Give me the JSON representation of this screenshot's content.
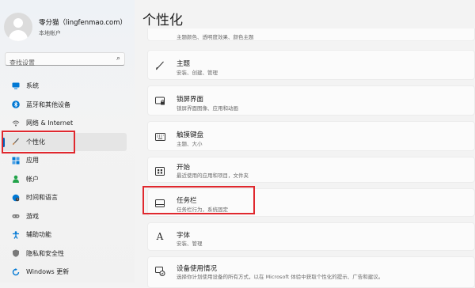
{
  "user": {
    "name": "零分猫（lingfenmao.com）",
    "account_type": "本地帐户"
  },
  "search": {
    "placeholder": "查找设置"
  },
  "sidebar": {
    "items": [
      {
        "label": "系统",
        "icon": "monitor-icon",
        "color": "#0078d4"
      },
      {
        "label": "蓝牙和其他设备",
        "icon": "bluetooth-icon",
        "color": "#0078d4"
      },
      {
        "label": "网络 & Internet",
        "icon": "wifi-icon",
        "color": "#606060"
      },
      {
        "label": "个性化",
        "icon": "brush-icon",
        "color": "#c07a3a"
      },
      {
        "label": "应用",
        "icon": "apps-icon",
        "color": "#0078d4"
      },
      {
        "label": "帐户",
        "icon": "account-icon",
        "color": "#22a34a"
      },
      {
        "label": "时间和语言",
        "icon": "globe-clock-icon",
        "color": "#0078d4"
      },
      {
        "label": "游戏",
        "icon": "gamepad-icon",
        "color": "#606060"
      },
      {
        "label": "辅助功能",
        "icon": "accessibility-icon",
        "color": "#0078d4"
      },
      {
        "label": "隐私和安全性",
        "icon": "shield-icon",
        "color": "#606060"
      },
      {
        "label": "Windows 更新",
        "icon": "update-icon",
        "color": "#0078d4"
      }
    ],
    "active_item": "个性化"
  },
  "main": {
    "title": "个性化",
    "partial_subtitle": "主题颜色、透明度效果、颜色主题",
    "cards": [
      {
        "title": "主题",
        "subtitle": "安装、创建、管理",
        "icon": "brush-icon"
      },
      {
        "title": "锁屏界面",
        "subtitle": "锁屏界面图像、应用和动画",
        "icon": "lock-screen-icon"
      },
      {
        "title": "触摸键盘",
        "subtitle": "主题、大小",
        "icon": "keyboard-icon"
      },
      {
        "title": "开始",
        "subtitle": "最近使用的应用和项目，文件夹",
        "icon": "start-icon"
      },
      {
        "title": "任务栏",
        "subtitle": "任务栏行为，系统固定",
        "icon": "taskbar-icon"
      },
      {
        "title": "字体",
        "subtitle": "安装、管理",
        "icon": "font-icon"
      },
      {
        "title": "设备使用情况",
        "subtitle": "选择你计划使用设备的所有方式，以在 Microsoft 体验中获取个性化的提示、广告和建议。",
        "icon": "device-usage-icon"
      }
    ]
  },
  "colors": {
    "accent": "#005fb8",
    "highlight_border": "#e0282e"
  }
}
